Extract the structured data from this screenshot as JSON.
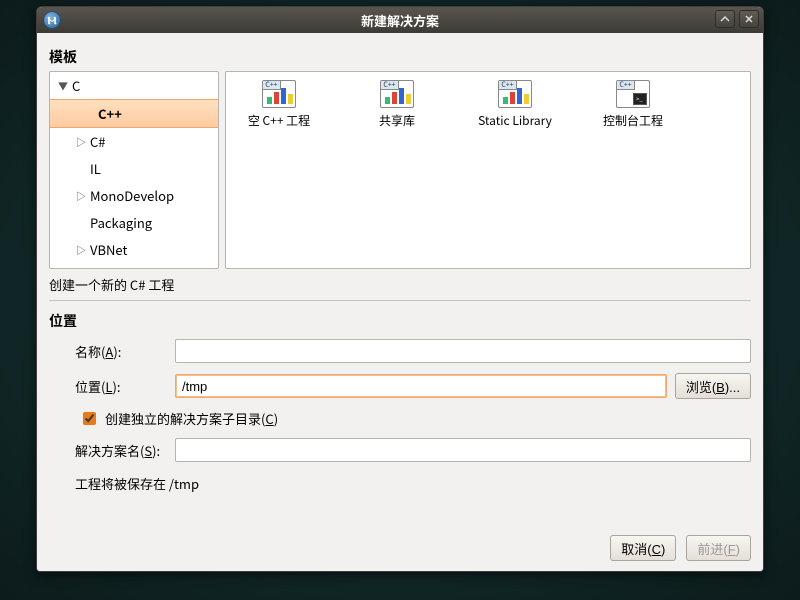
{
  "window": {
    "title": "新建解决方案"
  },
  "sections": {
    "template": "模板",
    "location": "位置"
  },
  "tree": {
    "items": [
      {
        "label": "C",
        "expander": "▼"
      },
      {
        "label": "C++"
      },
      {
        "label": "C#",
        "expander": "▷"
      },
      {
        "label": "IL"
      },
      {
        "label": "MonoDevelop",
        "expander": "▷"
      },
      {
        "label": "Packaging"
      },
      {
        "label": "VBNet",
        "expander": "▷"
      }
    ]
  },
  "templates": {
    "icon_tab": "C++",
    "items": [
      {
        "label": "空 C++ 工程"
      },
      {
        "label": "共享库"
      },
      {
        "label": "Static Library"
      },
      {
        "label": "控制台工程"
      }
    ],
    "description": "创建一个新的 C# 工程"
  },
  "form": {
    "name_label": "名称(",
    "name_accel": "A",
    "name_label_suffix": "):",
    "location_label": "位置(",
    "location_accel": "L",
    "location_label_suffix": "):",
    "location_value": "/tmp",
    "browse_label": "浏览(",
    "browse_accel": "B",
    "browse_suffix": ")...",
    "subdir_label": "创建独立的解决方案子目录(",
    "subdir_accel": "C",
    "subdir_suffix": ")",
    "subdir_checked": true,
    "solution_label": "解决方案名(",
    "solution_accel": "S",
    "solution_suffix": "):",
    "save_hint": "工程将被保存在 /tmp"
  },
  "footer": {
    "cancel_label": "取消(",
    "cancel_accel": "C",
    "cancel_suffix": ")",
    "forward_label": "前进(",
    "forward_accel": "F",
    "forward_suffix": ")"
  }
}
